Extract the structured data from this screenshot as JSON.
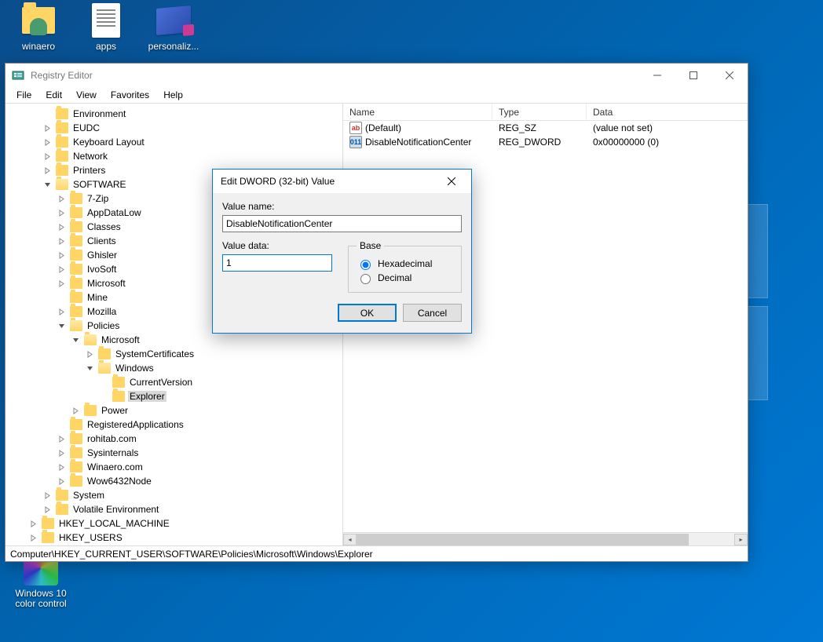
{
  "desktop": {
    "icons": [
      {
        "label": "winaero",
        "kind": "folder-person"
      },
      {
        "label": "apps",
        "kind": "text-doc"
      },
      {
        "label": "personaliz...",
        "kind": "personaliz"
      }
    ],
    "icons2": [
      {
        "label": "Windows 10 color control",
        "kind": "color-ctrl"
      }
    ]
  },
  "window": {
    "title": "Registry Editor",
    "menu": [
      "File",
      "Edit",
      "View",
      "Favorites",
      "Help"
    ],
    "tree": [
      {
        "n": "Environment",
        "e": "│"
      },
      {
        "n": "EUDC",
        "e": "▸"
      },
      {
        "n": "Keyboard Layout",
        "e": "▸"
      },
      {
        "n": "Network",
        "e": "▸"
      },
      {
        "n": "Printers",
        "e": "▸"
      },
      {
        "n": "SOFTWARE",
        "e": "▾",
        "open": true,
        "c": [
          {
            "n": "7-Zip",
            "e": "▸"
          },
          {
            "n": "AppDataLow",
            "e": "▸"
          },
          {
            "n": "Classes",
            "e": "▸"
          },
          {
            "n": "Clients",
            "e": "▸"
          },
          {
            "n": "Ghisler",
            "e": "▸"
          },
          {
            "n": "IvoSoft",
            "e": "▸"
          },
          {
            "n": "Microsoft",
            "e": "▸"
          },
          {
            "n": "Mine",
            "e": "│"
          },
          {
            "n": "Mozilla",
            "e": "▸"
          },
          {
            "n": "Policies",
            "e": "▾",
            "open": true,
            "c": [
              {
                "n": "Microsoft",
                "e": "▾",
                "open": true,
                "c": [
                  {
                    "n": "SystemCertificates",
                    "e": "▸"
                  },
                  {
                    "n": "Windows",
                    "e": "▾",
                    "open": true,
                    "c": [
                      {
                        "n": "CurrentVersion",
                        "e": "│"
                      },
                      {
                        "n": "Explorer",
                        "e": "│",
                        "sel": true
                      }
                    ]
                  }
                ]
              },
              {
                "n": "Power",
                "e": "▸"
              }
            ]
          },
          {
            "n": "RegisteredApplications",
            "e": "│"
          },
          {
            "n": "rohitab.com",
            "e": "▸"
          },
          {
            "n": "Sysinternals",
            "e": "▸"
          },
          {
            "n": "Winaero.com",
            "e": "▸"
          },
          {
            "n": "Wow6432Node",
            "e": "▸"
          }
        ]
      },
      {
        "n": "System",
        "e": "▸"
      },
      {
        "n": "Volatile Environment",
        "e": "▸"
      },
      {
        "n": "HKEY_LOCAL_MACHINE",
        "e": "▸",
        "depth": -1
      },
      {
        "n": "HKEY_USERS",
        "e": "▸",
        "depth": -1
      }
    ],
    "columns": {
      "name": "Name",
      "type": "Type",
      "data": "Data"
    },
    "rows": [
      {
        "icon": "sz",
        "name": "(Default)",
        "type": "REG_SZ",
        "data": "(value not set)"
      },
      {
        "icon": "dw",
        "name": "DisableNotificationCenter",
        "type": "REG_DWORD",
        "data": "0x00000000 (0)"
      }
    ],
    "statusbar": "Computer\\HKEY_CURRENT_USER\\SOFTWARE\\Policies\\Microsoft\\Windows\\Explorer"
  },
  "dialog": {
    "title": "Edit DWORD (32-bit) Value",
    "valuename_label": "Value name:",
    "valuename": "DisableNotificationCenter",
    "valuedata_label": "Value data:",
    "valuedata": "1",
    "base_label": "Base",
    "hex": "Hexadecimal",
    "dec": "Decimal",
    "ok": "OK",
    "cancel": "Cancel"
  }
}
